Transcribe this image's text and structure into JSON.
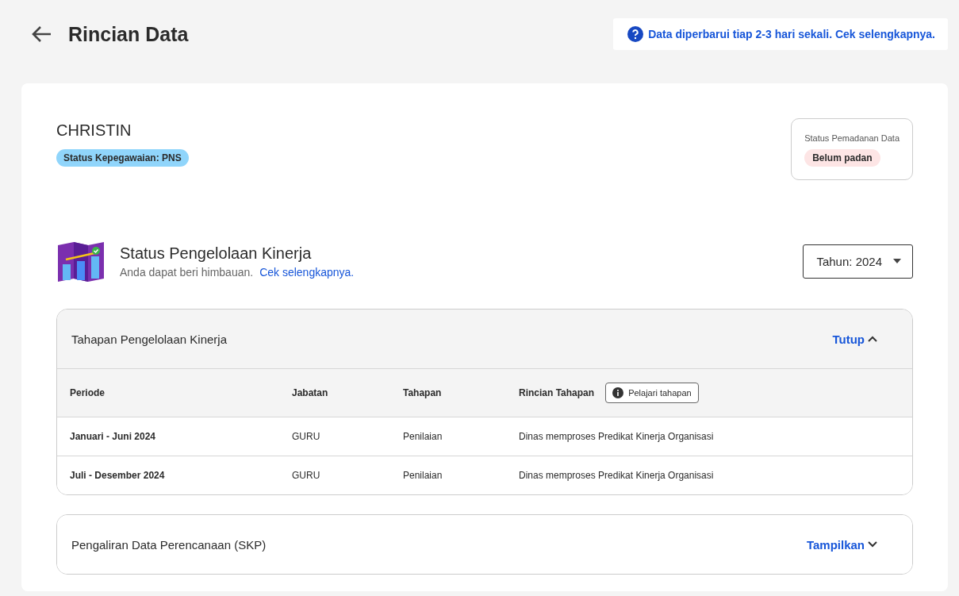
{
  "header": {
    "title": "Rincian Data",
    "notice": "Data diperbarui tiap 2-3 hari sekali. Cek selengkapnya."
  },
  "profile": {
    "name": "CHRISTIN",
    "employment_badge": "Status Kepegawaian: PNS",
    "match_status": {
      "label": "Status Pemadanan Data",
      "value": "Belum padan"
    }
  },
  "performance": {
    "title": "Status Pengelolaan Kinerja",
    "subtitle": "Anda dapat beri himbauan.",
    "link": "Cek selengkapnya.",
    "year_select": "Tahun: 2024"
  },
  "sections": [
    {
      "title": "Tahapan Pengelolaan Kinerja",
      "toggle": "Tutup",
      "expanded": true,
      "table": {
        "columns": [
          "Periode",
          "Jabatan",
          "Tahapan",
          "Rincian Tahapan"
        ],
        "learn_button": "Pelajari tahapan",
        "rows": [
          [
            "Januari - Juni 2024",
            "GURU",
            "Penilaian",
            "Dinas memproses Predikat Kinerja Organisasi"
          ],
          [
            "Juli - Desember 2024",
            "GURU",
            "Penilaian",
            "Dinas memproses Predikat Kinerja Organisasi"
          ]
        ]
      }
    },
    {
      "title": "Pengaliran Data Perencanaan (SKP)",
      "toggle": "Tampilkan",
      "expanded": false
    }
  ]
}
